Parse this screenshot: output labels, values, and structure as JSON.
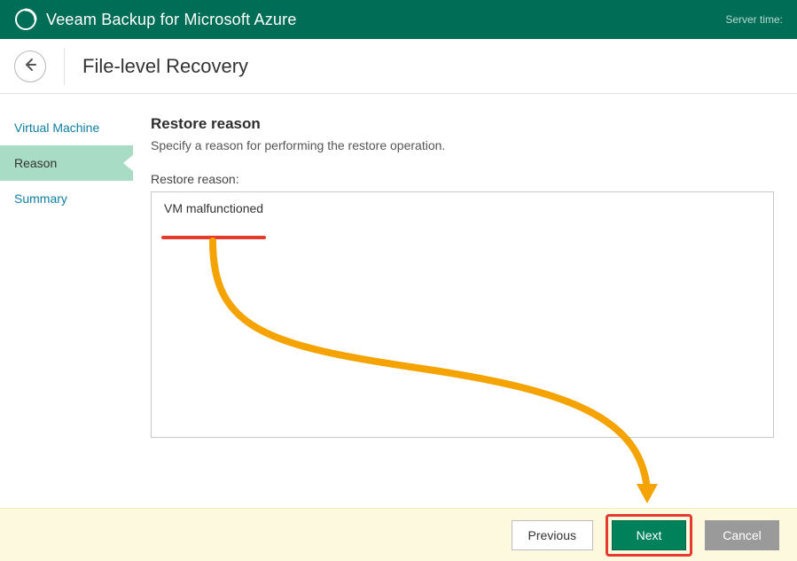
{
  "brand": {
    "title": "Veeam Backup for Microsoft Azure"
  },
  "server_time": {
    "label": "Server time:"
  },
  "page": {
    "title": "File-level Recovery"
  },
  "sidebar": {
    "items": [
      {
        "label": "Virtual Machine"
      },
      {
        "label": "Reason"
      },
      {
        "label": "Summary"
      }
    ]
  },
  "section": {
    "title": "Restore reason",
    "desc": "Specify a reason for performing the restore operation.",
    "field_label": "Restore reason:",
    "value": "VM malfunctioned"
  },
  "footer": {
    "previous": "Previous",
    "next": "Next",
    "cancel": "Cancel"
  }
}
